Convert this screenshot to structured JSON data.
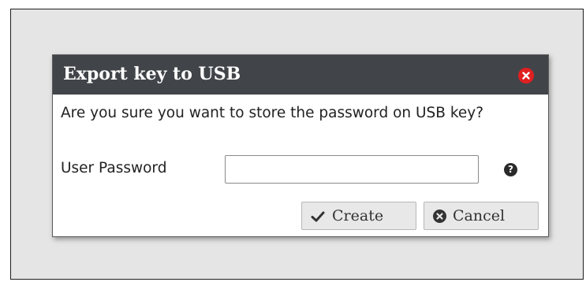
{
  "dialog": {
    "title": "Export key to USB",
    "message": "Are you sure you want to store the password on USB key?",
    "password_label": "User Password",
    "password_value": "",
    "help_symbol": "?",
    "create_label": "Create",
    "cancel_label": "Cancel"
  },
  "icons": {
    "close": "close-icon",
    "help": "question-circle-icon",
    "create": "check-icon",
    "cancel": "x-circle-icon"
  },
  "colors": {
    "titlebar": "#414449",
    "close": "#e02020",
    "button_bg": "#e8e8e8",
    "backdrop": "#e5e5e5"
  }
}
